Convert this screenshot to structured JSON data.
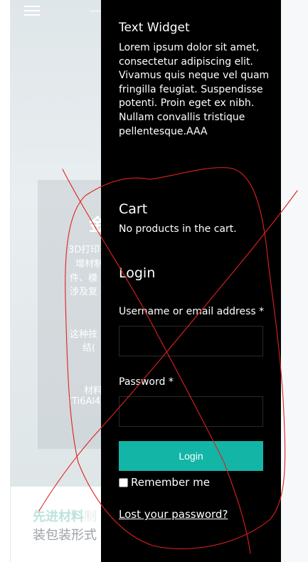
{
  "background": {
    "hero_heading": "金",
    "card_lines": [
      "3D打印",
      "增材制",
      "件、模",
      "涉及复",
      "这种技",
      "结(",
      "材料",
      "(Ti6Al4"
    ],
    "bottom_title_accent": "先进材料",
    "bottom_title_rest": "制",
    "bottom_subtitle": "装包装形式"
  },
  "text_widget": {
    "title": "Text Widget",
    "body": "Lorem ipsum dolor sit amet, consectetur adipiscing elit. Vivamus quis neque vel quam fringilla feugiat. Suspendisse potenti. Proin eget ex nibh. Nullam convallis tristique pellentesque.AAA"
  },
  "cart": {
    "title": "Cart",
    "empty_message": "No products in the cart."
  },
  "login": {
    "title": "Login",
    "username_label": "Username or email address *",
    "username_value": "",
    "password_label": "Password *",
    "password_value": "",
    "submit_label": "Login",
    "remember_label": "Remember me",
    "remember_checked": false,
    "lost_password_label": "Lost your password?"
  },
  "colors": {
    "panel_bg": "#000000",
    "button_accent": "#13b5a6",
    "annotation": "#e02020"
  },
  "icons": {
    "menu": "hamburger-menu-icon",
    "checkbox": "checkbox-unchecked-icon"
  }
}
